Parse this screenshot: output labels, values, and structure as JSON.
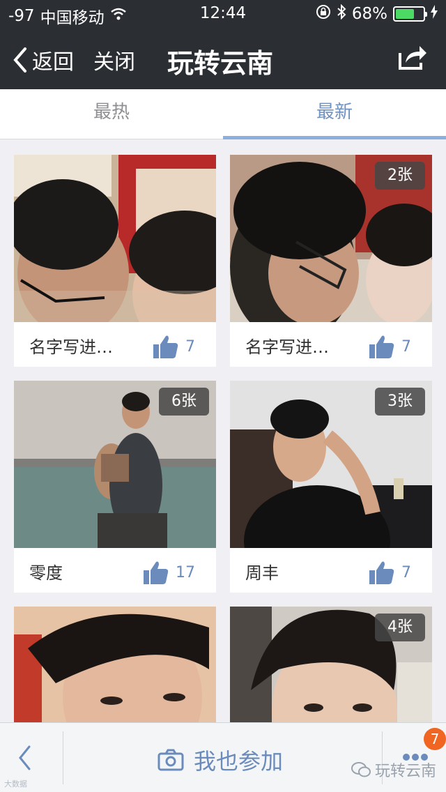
{
  "status": {
    "signal": "-97",
    "carrier": "中国移动",
    "time": "12:44",
    "battery": "68%",
    "battery_level": 0.68
  },
  "nav": {
    "back_label": "返回",
    "close_label": "关闭",
    "title": "玩转云南"
  },
  "tabs": [
    {
      "label": "最热",
      "active": false
    },
    {
      "label": "最新",
      "active": true
    }
  ],
  "cards": [
    {
      "name": "名字写进…",
      "likes": "7",
      "count": ""
    },
    {
      "name": "名字写进…",
      "likes": "7",
      "count": "2张"
    },
    {
      "name": "零度",
      "likes": "17",
      "count": "6张"
    },
    {
      "name": "周丰",
      "likes": "7",
      "count": "3张"
    },
    {
      "name": "",
      "likes": "",
      "count": ""
    },
    {
      "name": "",
      "likes": "",
      "count": "4张"
    }
  ],
  "bottom": {
    "join_label": "我也参加",
    "badge": "7"
  },
  "watermark": {
    "text": "玩转云南",
    "small_text": "大数据"
  },
  "colors": {
    "bar_dark": "#2b2e33",
    "accent": "#6f92c2",
    "badge": "#f06522",
    "battery": "#4cd964"
  }
}
